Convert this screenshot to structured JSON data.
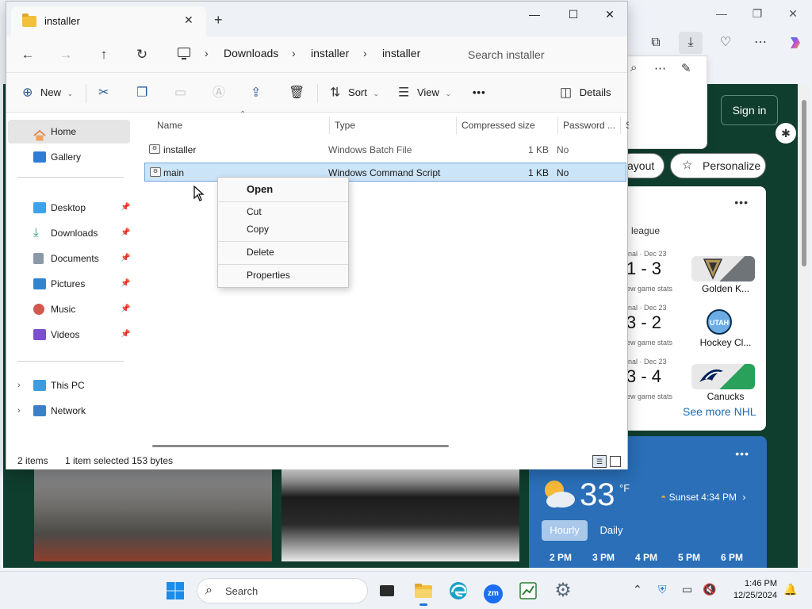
{
  "explorer": {
    "tab_title": "installer",
    "new_tab_symbol": "+",
    "nav": {
      "back_symbol": "←",
      "forward_symbol": "→",
      "up_symbol": "↑",
      "refresh_symbol": "↻"
    },
    "breadcrumb": [
      "Downloads",
      "installer",
      "installer"
    ],
    "search_placeholder": "Search installer",
    "commands": {
      "new": "New",
      "sort": "Sort",
      "view": "View",
      "more": "•••",
      "details": "Details"
    },
    "sidebar": {
      "home": "Home",
      "gallery": "Gallery",
      "quick_access": [
        {
          "label": "Desktop"
        },
        {
          "label": "Downloads"
        },
        {
          "label": "Documents"
        },
        {
          "label": "Pictures"
        },
        {
          "label": "Music"
        },
        {
          "label": "Videos"
        }
      ],
      "this_pc": "This PC",
      "network": "Network"
    },
    "columns": [
      "Name",
      "Type",
      "Compressed size",
      "Password ...",
      "Si"
    ],
    "files": [
      {
        "name": "installer",
        "type": "Windows Batch File",
        "size": "1 KB",
        "password": "No"
      },
      {
        "name": "main",
        "type": "Windows Command Script",
        "size": "1 KB",
        "password": "No"
      }
    ],
    "status": {
      "items": "2 items",
      "selected": "1 item selected",
      "bytes": "153 bytes"
    }
  },
  "context_menu": {
    "open": "Open",
    "cut": "Cut",
    "copy": "Copy",
    "delete": "Delete",
    "properties": "Properties"
  },
  "browser": {
    "sign_in": "Sign in",
    "layout_label": "ayout",
    "personalize": "Personalize",
    "more": "•••",
    "nhl": {
      "league": "league",
      "games": [
        {
          "final": "inal · Dec 23",
          "score": "1 - 3",
          "stats": "ew game stats",
          "team": "Golden K..."
        },
        {
          "final": "inal · Dec 23",
          "score": "3 - 2",
          "stats": "ew game stats",
          "team": "Hockey Cl..."
        },
        {
          "final": "inal · Dec 23",
          "score": "3 - 4",
          "stats": "ew game stats",
          "team": "Canucks"
        }
      ],
      "see_more": "See more NHL"
    },
    "weather": {
      "temp": "33",
      "unit": "°F",
      "sunset": "Sunset 4:34 PM",
      "tabs": [
        "Hourly",
        "Daily"
      ],
      "hours": [
        "2 PM",
        "3 PM",
        "4 PM",
        "5 PM",
        "6 PM"
      ]
    }
  },
  "taskbar": {
    "search_label": "Search",
    "time": "1:46 PM",
    "date": "12/25/2024"
  }
}
